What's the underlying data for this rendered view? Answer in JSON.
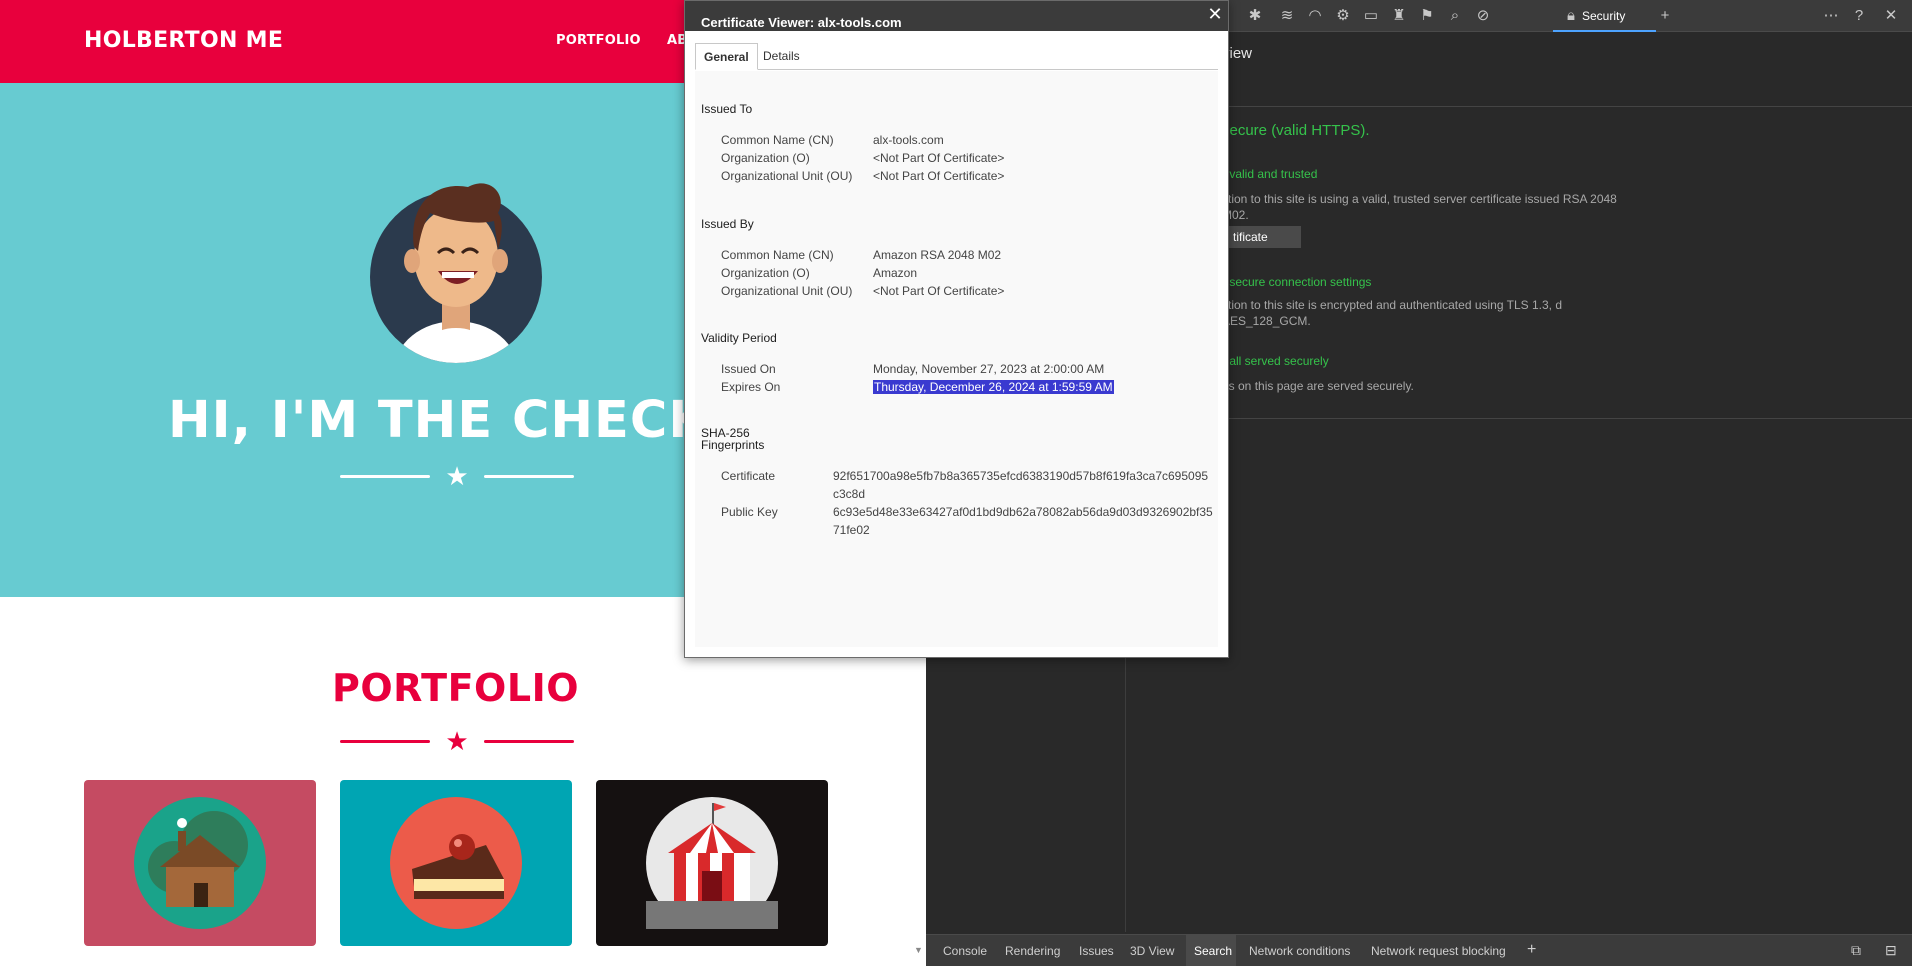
{
  "website": {
    "brand": "HOLBERTON ME",
    "nav": [
      "PORTFOLIO",
      "AB"
    ],
    "hero_title": "HI, I'M THE CHECKE",
    "portfolio_title": "PORTFOLIO",
    "colors": {
      "primary": "#e8003d",
      "hero_bg": "#67cbd1"
    },
    "cards": [
      {
        "icon": "cabin-icon",
        "bg": "#c54b62"
      },
      {
        "icon": "cake-icon",
        "bg": "#00a5b3"
      },
      {
        "icon": "circus-tent-icon",
        "bg": "#151111"
      }
    ]
  },
  "devtools": {
    "active_tab": "Security",
    "overview_heading": "view",
    "summary": "secure (valid HTTPS).",
    "sections": [
      {
        "heading": "- valid and trusted",
        "text": "ction to this site is using a valid, trusted server certificate issued RSA 2048 M02."
      },
      {
        "heading": "- secure connection settings",
        "text": "ction to this site is encrypted and authenticated using TLS 1.3, d AES_128_GCM."
      },
      {
        "heading": "- all served securely",
        "text": "es on this page are served securely."
      }
    ],
    "view_cert_button": "tificate",
    "drawer_tabs": [
      "Console",
      "Rendering",
      "Issues",
      "3D View",
      "Search",
      "Network conditions",
      "Network request blocking"
    ],
    "drawer_active": "Search"
  },
  "cert": {
    "title": "Certificate Viewer: alx-tools.com",
    "tabs": [
      "General",
      "Details"
    ],
    "issued_to": {
      "heading": "Issued To",
      "rows": [
        {
          "label": "Common Name (CN)",
          "value": "alx-tools.com"
        },
        {
          "label": "Organization (O)",
          "value": "<Not Part Of Certificate>"
        },
        {
          "label": "Organizational Unit (OU)",
          "value": "<Not Part Of Certificate>"
        }
      ]
    },
    "issued_by": {
      "heading": "Issued By",
      "rows": [
        {
          "label": "Common Name (CN)",
          "value": "Amazon RSA 2048 M02"
        },
        {
          "label": "Organization (O)",
          "value": "Amazon"
        },
        {
          "label": "Organizational Unit (OU)",
          "value": "<Not Part Of Certificate>"
        }
      ]
    },
    "validity": {
      "heading": "Validity Period",
      "rows": [
        {
          "label": "Issued On",
          "value": "Monday, November 27, 2023 at 2:00:00 AM"
        },
        {
          "label": "Expires On",
          "value": "Thursday, December 26, 2024 at 1:59:59 AM"
        }
      ]
    },
    "fingerprints": {
      "heading_1": "SHA-256",
      "heading_2": "Fingerprints",
      "rows": [
        {
          "label": "Certificate",
          "value": "92f651700a98e5fb7b8a365735efcd6383190d57b8f619fa3ca7c695095c3c8d"
        },
        {
          "label": "Public Key",
          "value": "6c93e5d48e33e63427af0d1bd9db62a78082ab56da9d03d9326902bf3571fe02"
        }
      ]
    }
  }
}
